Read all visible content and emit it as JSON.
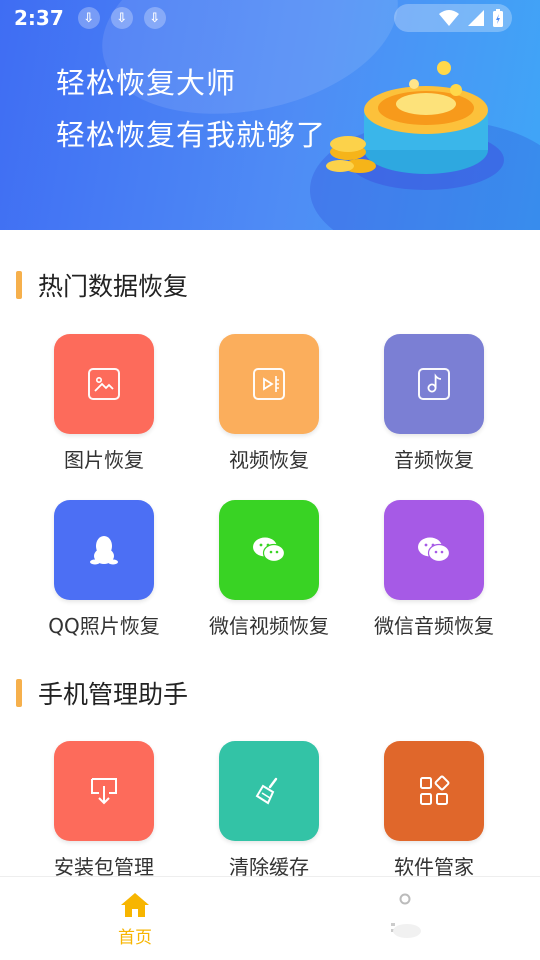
{
  "status_bar": {
    "time": "2:37",
    "download_icons": [
      "download-icon",
      "download-icon",
      "download-icon"
    ],
    "right_icons": [
      "wifi-icon",
      "signal-icon",
      "battery-icon"
    ]
  },
  "banner": {
    "line1": "轻松恢复大师",
    "line2": "轻松恢复有我就够了"
  },
  "hot_recovery": {
    "title": "热门数据恢复",
    "items": [
      {
        "label": "图片恢复",
        "icon": "image-icon",
        "color": "#fd6b5b"
      },
      {
        "label": "视频恢复",
        "icon": "video-icon",
        "color": "#fbae5c"
      },
      {
        "label": "音频恢复",
        "icon": "music-note-icon",
        "color": "#7b7fd4"
      },
      {
        "label": "QQ照片恢复",
        "icon": "qq-penguin-icon",
        "color": "#4c6ff4"
      },
      {
        "label": "微信视频恢复",
        "icon": "wechat-icon",
        "color": "#39d324"
      },
      {
        "label": "微信音频恢复",
        "icon": "wechat-icon",
        "color": "#a65ae6"
      }
    ]
  },
  "phone_manager": {
    "title": "手机管理助手",
    "items": [
      {
        "label": "安装包管理",
        "icon": "install-package-icon",
        "color": "#fd6b5b"
      },
      {
        "label": "清除缓存",
        "icon": "broom-icon",
        "color": "#33c3a6"
      },
      {
        "label": "软件管家",
        "icon": "apps-grid-icon",
        "color": "#e0672b"
      }
    ]
  },
  "bottom_nav": {
    "home_label": "首页",
    "home_color": "#f7b500"
  }
}
